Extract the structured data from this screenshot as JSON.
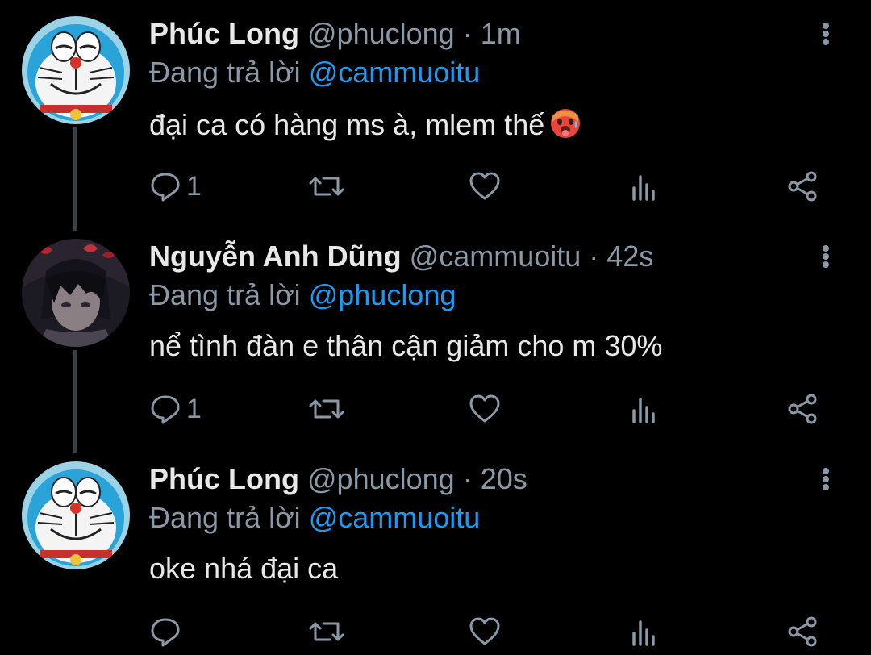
{
  "replying_prefix": "Đang trả lời",
  "tweets": [
    {
      "name": "Phúc Long",
      "handle": "@phuclong",
      "separator": "·",
      "time": "1m",
      "replying_to": "@cammuoitu",
      "text": "đại ca có hàng ms à, mlem thế",
      "reply_count": "1",
      "avatar": "doraemon-avatar"
    },
    {
      "name": "Nguyễn Anh Dũng",
      "handle": "@cammuoitu",
      "separator": "·",
      "time": "42s",
      "replying_to": "@phuclong",
      "text": "nể tình đàn e thân cận giảm cho m 30%",
      "reply_count": "1",
      "avatar": "anime-boy-avatar"
    },
    {
      "name": "Phúc Long",
      "handle": "@phuclong",
      "separator": "·",
      "time": "20s",
      "replying_to": "@cammuoitu",
      "text": "oke nhá đại ca",
      "reply_count": "",
      "avatar": "doraemon-avatar"
    }
  ],
  "colors": {
    "background": "#000000",
    "primary_text": "#e8e8e8",
    "secondary_text": "#8b98a5",
    "mention": "#1d9bf0"
  },
  "icons": [
    "reply-icon",
    "retweet-icon",
    "like-icon",
    "analytics-icon",
    "share-icon",
    "more-options-icon",
    "hot-face-emoji"
  ]
}
